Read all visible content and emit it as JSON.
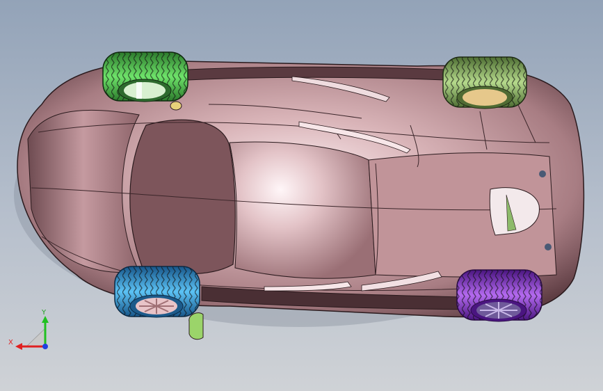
{
  "viewport": {
    "model": "car-body-top-view",
    "body_color": "#c9a2a6",
    "background_top": "#93a3b8",
    "background_bottom": "#cfd2d6"
  },
  "wheels": {
    "front_left_color": "#44b945",
    "rear_left_color": "#8fb86a",
    "front_right_color": "#2b93d6",
    "rear_right_color": "#8a2bd6"
  },
  "triad": {
    "x_label": "X",
    "y_label": "Y",
    "x_color": "#e02020",
    "y_color": "#20c020",
    "z_color": "#2040e0"
  }
}
